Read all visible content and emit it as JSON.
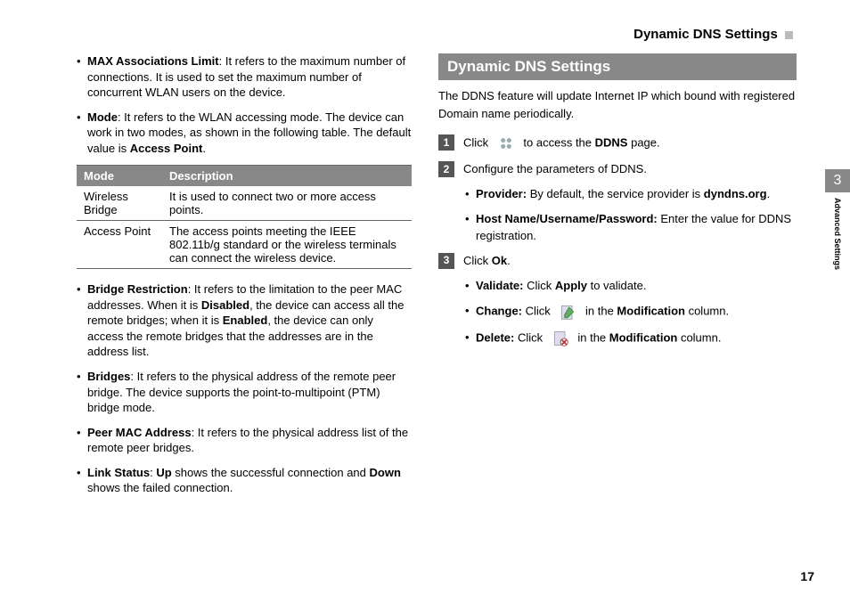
{
  "header_right": "Dynamic DNS Settings",
  "left": {
    "bullets_top": [
      {
        "label": "MAX Associations Limit",
        "rest": ": It refers to the maximum number of connections. It is used to set the maximum number of concurrent WLAN users on the device."
      },
      {
        "label": "Mode",
        "rest": ": It refers to the WLAN accessing mode. The device can work in two modes, as shown in the following table. The default value is ",
        "trail_bold": "Access Point",
        "trail_after": "."
      }
    ],
    "table": {
      "h1": "Mode",
      "h2": "Description",
      "rows": [
        {
          "c1": "Wireless Bridge",
          "c2": "It is used to connect two or more access points."
        },
        {
          "c1": "Access Point",
          "c2": "The access points meeting the IEEE 802.11b/g standard or the wireless terminals can connect the wireless device."
        }
      ]
    },
    "bullets_bottom": [
      {
        "label": "Bridge Restriction",
        "parts": [
          ": It refers to the limitation to the peer MAC addresses. When it is ",
          {
            "b": "Disabled"
          },
          ", the device can access all the remote bridges; when it is ",
          {
            "b": "Enabled"
          },
          ", the device can only access the remote bridges that the addresses are in the address list."
        ]
      },
      {
        "label": "Bridges",
        "parts": [
          ": It refers to the physical address of the remote peer bridge. The device supports the point-to-multipoint (PTM) bridge mode."
        ]
      },
      {
        "label": "Peer MAC Address",
        "parts": [
          ": It refers to the physical address list of the remote peer bridges."
        ]
      },
      {
        "label": "Link Status",
        "parts": [
          ": ",
          {
            "b": "Up"
          },
          " shows the successful connection and ",
          {
            "b": "Down"
          },
          " shows the failed connection."
        ]
      }
    ]
  },
  "right": {
    "section_title": "Dynamic DNS Settings",
    "intro": "The DDNS feature will update Internet IP which bound with registered Domain name periodically.",
    "step1": {
      "pre": "Click",
      "post_a": " to access the ",
      "bold": "DDNS",
      "post_b": " page."
    },
    "step2": {
      "text": "Configure the parameters of DDNS.",
      "subs": [
        {
          "label": "Provider:",
          "rest": " By default, the service provider is ",
          "bold": "dyndns.org",
          "after": "."
        },
        {
          "label": "Host Name/Username/Password:",
          "rest": " Enter the value for DDNS registration."
        }
      ]
    },
    "step3": {
      "pre": "Click ",
      "bold": "Ok",
      "after": "."
    },
    "actions": [
      {
        "label": "Validate:",
        "rest": " Click ",
        "bold": "Apply",
        "after": " to validate."
      },
      {
        "label": "Change:",
        "rest": " Click ",
        "icon": "edit",
        "after_a": " in the ",
        "bold": "Modification",
        "after_b": " column."
      },
      {
        "label": "Delete:",
        "rest": " Click ",
        "icon": "delete",
        "after_a": " in the ",
        "bold": "Modification",
        "after_b": " column."
      }
    ]
  },
  "side": {
    "num": "3",
    "label": "Advanced Settings"
  },
  "pagenum": "17"
}
